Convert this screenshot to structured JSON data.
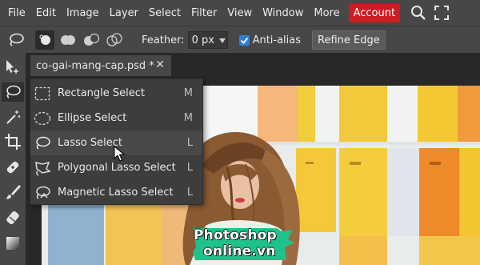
{
  "menubar": {
    "items": [
      "File",
      "Edit",
      "Image",
      "Layer",
      "Select",
      "Filter",
      "View",
      "Window",
      "More"
    ],
    "account": "Account",
    "account_color": "#cc1c24"
  },
  "options": {
    "feather_label": "Feather:",
    "feather_value": "0 px",
    "feather_unit_icon": "chevron-down-icon",
    "antialias_label": "Anti-alias",
    "antialias_checked": true,
    "refine_label": "Refine Edge",
    "checkbox_color": "#2d80d6"
  },
  "document": {
    "tab_title": "co-gai-mang-cap.psd *",
    "tab_close": "✕"
  },
  "flyout": {
    "items": [
      {
        "label": "Rectangle Select",
        "shortcut": "M",
        "icon": "rectangle-select-icon"
      },
      {
        "label": "Ellipse Select",
        "shortcut": "M",
        "icon": "ellipse-select-icon"
      },
      {
        "label": "Lasso Select",
        "shortcut": "L",
        "icon": "lasso-icon"
      },
      {
        "label": "Polygonal Lasso Select",
        "shortcut": "L",
        "icon": "polygonal-lasso-icon"
      },
      {
        "label": "Magnetic Lasso Select",
        "shortcut": "L",
        "icon": "magnetic-lasso-icon"
      }
    ]
  },
  "watermark": {
    "line1": "Photoshop",
    "line2": "online.vn",
    "color": "#1fc28a"
  }
}
